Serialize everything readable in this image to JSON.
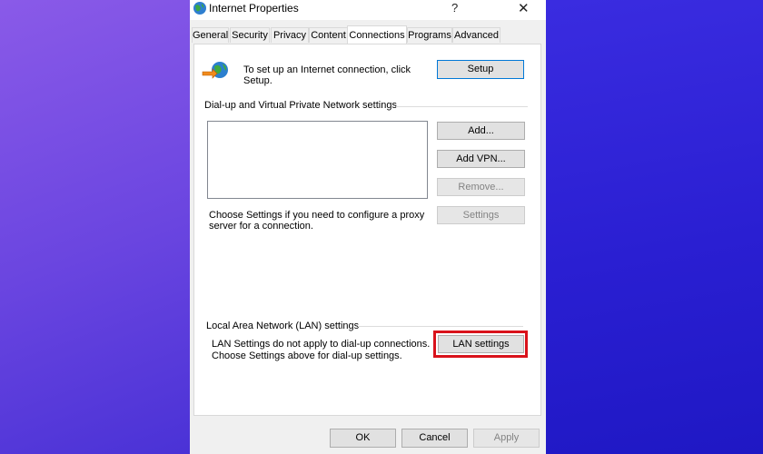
{
  "window": {
    "title": "Internet Properties",
    "help": "?",
    "close": "✕"
  },
  "tabs": [
    {
      "label": "General"
    },
    {
      "label": "Security"
    },
    {
      "label": "Privacy"
    },
    {
      "label": "Content"
    },
    {
      "label": "Connections"
    },
    {
      "label": "Programs"
    },
    {
      "label": "Advanced"
    }
  ],
  "active_tab": "Connections",
  "setup": {
    "text_line1": "To set up an Internet connection, click",
    "text_line2": "Setup.",
    "button": "Setup"
  },
  "dialup": {
    "group_label": "Dial-up and Virtual Private Network settings",
    "buttons": {
      "add": "Add...",
      "add_vpn": "Add VPN...",
      "remove": "Remove...",
      "settings": "Settings"
    },
    "hint_line1": "Choose Settings if you need to configure a proxy",
    "hint_line2": "server for a connection."
  },
  "lan": {
    "group_label": "Local Area Network (LAN) settings",
    "text_line1": "LAN Settings do not apply to dial-up connections.",
    "text_line2": "Choose Settings above for dial-up settings.",
    "button": "LAN settings"
  },
  "footer": {
    "ok": "OK",
    "cancel": "Cancel",
    "apply": "Apply"
  },
  "colors": {
    "highlight": "#d9121b",
    "accent_border": "#0078d7"
  }
}
